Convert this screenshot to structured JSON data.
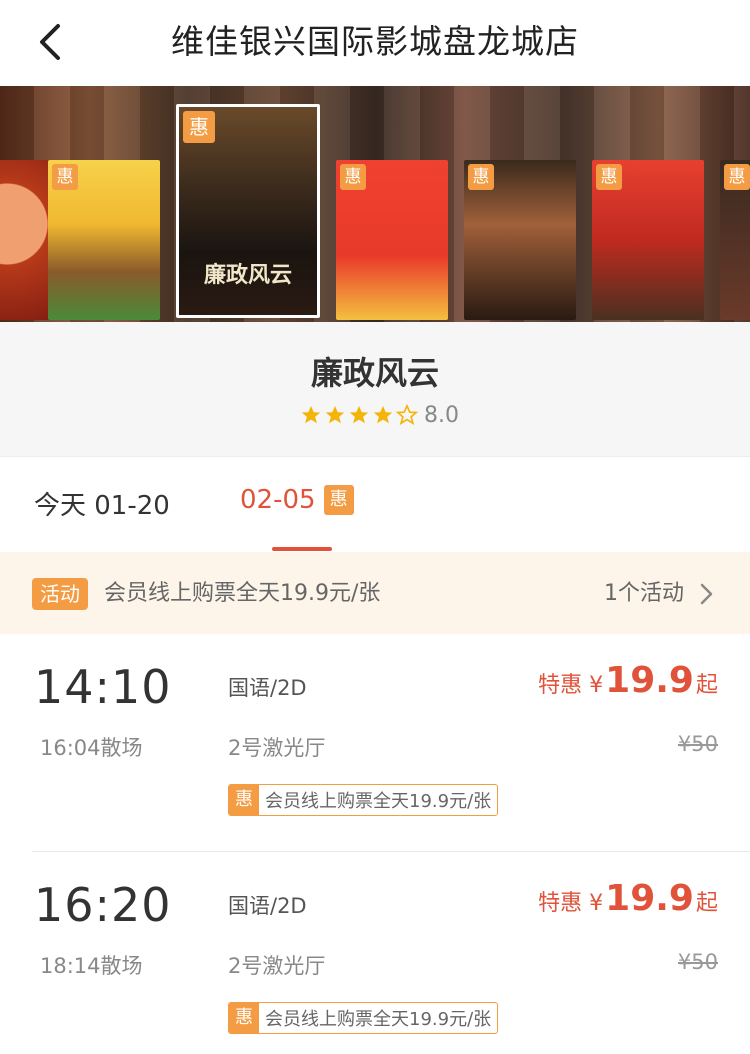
{
  "header": {
    "title": "维佳银兴国际影城盘龙城店"
  },
  "carousel": {
    "hui_label": "惠",
    "posters": [
      {
        "name": "poster-0",
        "title": "",
        "has_hui": false
      },
      {
        "name": "poster-1",
        "title": "",
        "has_hui": true
      },
      {
        "name": "poster-2",
        "title": "廉政风云",
        "has_hui": true,
        "selected": true
      },
      {
        "name": "poster-3",
        "title": "",
        "has_hui": true
      },
      {
        "name": "poster-4",
        "title": "",
        "has_hui": true
      },
      {
        "name": "poster-5",
        "title": "",
        "has_hui": true
      },
      {
        "name": "poster-6",
        "title": "",
        "has_hui": true
      }
    ]
  },
  "movie": {
    "name": "廉政风云",
    "stars": 4,
    "max_stars": 5,
    "score": "8.0"
  },
  "date_tabs": {
    "today": "今天 01-20",
    "selected": "02-05",
    "selected_badge": "惠"
  },
  "activity": {
    "tag": "活动",
    "text": "会员线上购票全天19.9元/张",
    "count": "1个活动"
  },
  "showtimes": [
    {
      "start": "14:10",
      "end": "16:04散场",
      "lang": "国语/2D",
      "hall": "2号激光厅",
      "price_prefix": "特惠 ¥",
      "price": "19.9",
      "price_suffix": "起",
      "original": "¥50",
      "promo_tag": "惠",
      "promo": "会员线上购票全天19.9元/张"
    },
    {
      "start": "16:20",
      "end": "18:14散场",
      "lang": "国语/2D",
      "hall": "2号激光厅",
      "price_prefix": "特惠 ¥",
      "price": "19.9",
      "price_suffix": "起",
      "original": "¥50",
      "promo_tag": "惠",
      "promo": "会员线上购票全天19.9元/张"
    }
  ],
  "colors": {
    "accent": "#e0533a",
    "badge": "#f39c44",
    "star": "#f5b40a"
  }
}
